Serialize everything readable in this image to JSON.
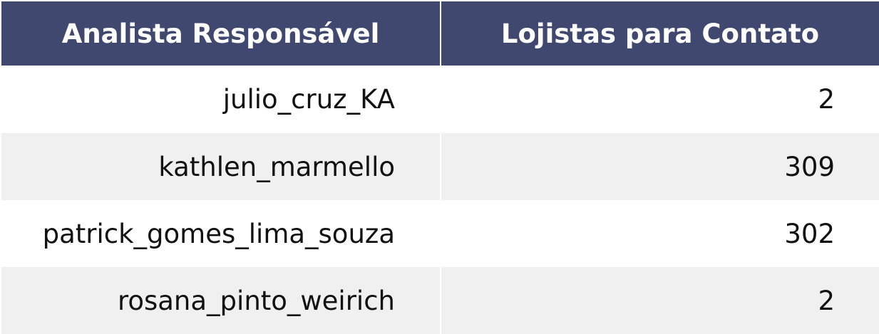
{
  "chart_data": {
    "type": "table",
    "columns": [
      "Analista Responsável",
      "Lojistas para Contato"
    ],
    "rows": [
      [
        "julio_cruz_KA",
        "2"
      ],
      [
        "kathlen_marmello",
        "309"
      ],
      [
        "patrick_gomes_lima_souza",
        "302"
      ],
      [
        "rosana_pinto_weirich",
        "2"
      ]
    ]
  },
  "colors": {
    "header_bg": "#414870",
    "header_text": "#ffffff",
    "row_alt_bg": "#f0f0f0",
    "row_bg": "#ffffff"
  }
}
